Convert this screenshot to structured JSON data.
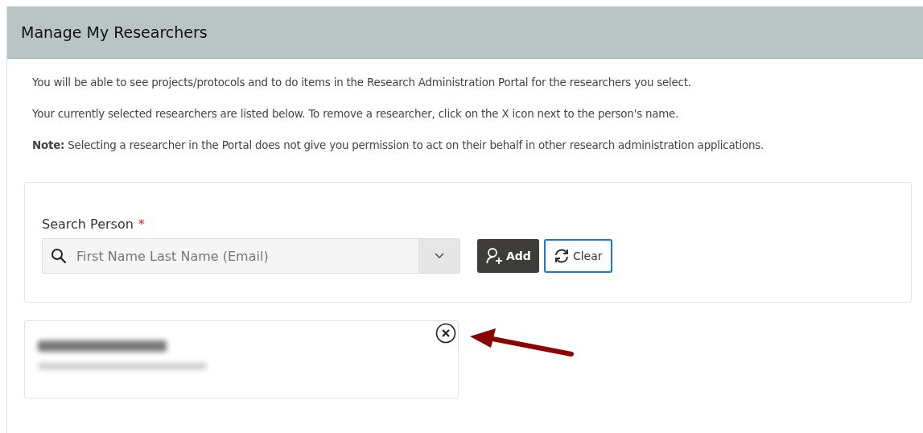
{
  "page": {
    "title": "Manage My Researchers"
  },
  "intro": [
    "You will be able to see projects/protocols and to do items in the Research Administration Portal for the researchers you select.",
    "Your currently selected researchers are listed below. To remove a researcher, click on the X icon next to the person's name.",
    "**Note:** Selecting a researcher in the Portal does not give you permission to act on their behalf in other research administration applications."
  ],
  "search": {
    "label": "Search Person",
    "required": true,
    "required_mark": "*",
    "placeholder": "First Name Last Name (Email)"
  },
  "buttons": [
    {
      "kind": "add",
      "label": "Add"
    },
    {
      "kind": "clear",
      "label": "Clear"
    }
  ],
  "researchers": [
    {
      "redacted": true
    }
  ]
}
